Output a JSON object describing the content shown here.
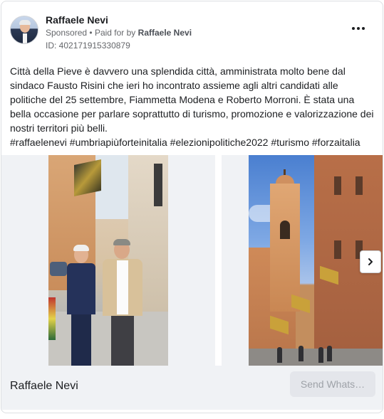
{
  "post": {
    "author": "Raffaele Nevi",
    "sponsored_label": "Sponsored",
    "separator": "•",
    "paid_for_prefix": "Paid for by",
    "paid_for_name": "Raffaele Nevi",
    "ad_id": "ID: 402171915330879",
    "more_icon": "more-horizontal-icon",
    "text_lines": [
      "Città della Pieve è davvero una splendida città, amministrata molto bene dal",
      "sindaco Fausto Risini che ieri ho incontrato assieme agli altri candidati alle",
      "politiche del 25 settembre, Fiammetta Modena e Roberto Morroni. È stata una",
      "bella occasione per parlare soprattutto di turismo, promozione e valorizzazione dei",
      "nostri territori più belli."
    ],
    "hashtags": "#raffaelenevi #umbriapiùforteinitalia #elezionipolitiche2022 #turismo #forzaitalia"
  },
  "carousel": {
    "next_icon": "chevron-right-icon"
  },
  "footer": {
    "title": "Raffaele Nevi",
    "cta_label": "Send Whats…"
  }
}
